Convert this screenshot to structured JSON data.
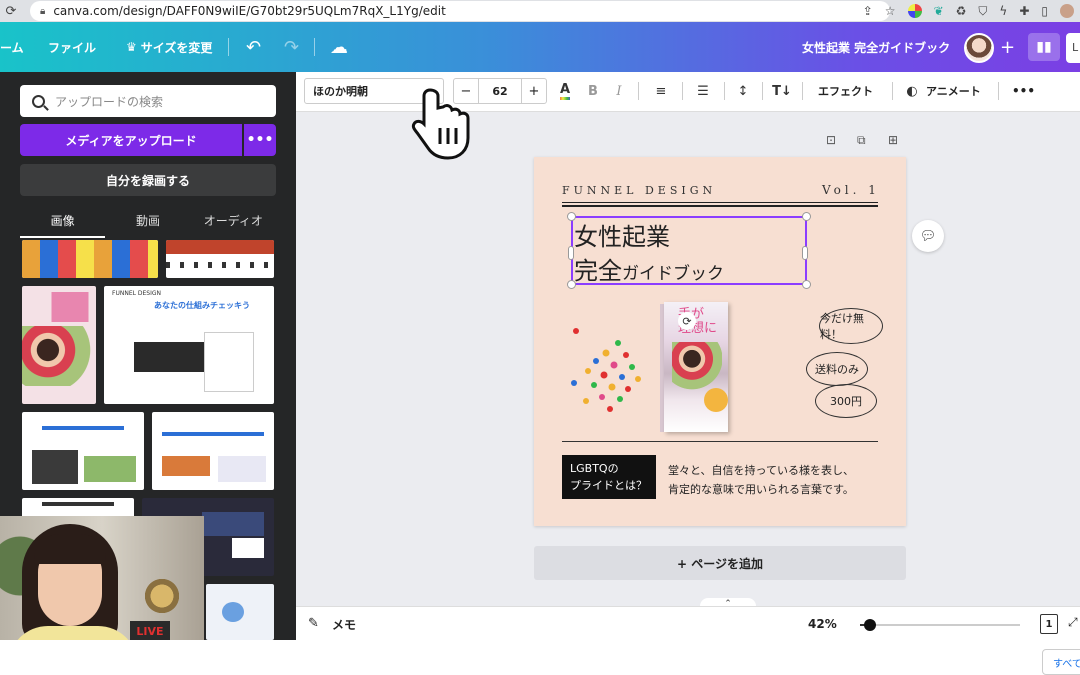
{
  "browser": {
    "url": "canva.com/design/DAFF0N9wiIE/G70bt29r5UQLm7RqX_L1Yg/edit"
  },
  "header": {
    "home_label": "ーム",
    "file_label": "ファイル",
    "resize_label": "サイズを変更",
    "doc_title": "女性起業 完全ガイドブック",
    "share_initial": "L"
  },
  "left_panel": {
    "search_placeholder": "アップロードの検索",
    "upload_label": "メディアをアップロード",
    "more_label": "•••",
    "record_label": "自分を録画する",
    "tabs": [
      {
        "label": "画像",
        "active": true
      },
      {
        "label": "動画",
        "active": false
      },
      {
        "label": "オーディオ",
        "active": false
      }
    ],
    "thumb_brand": "FUNNEL DESIGN",
    "thumb_heading": "あなたの仕組みチェッキう"
  },
  "webcam": {
    "sign_text": "LIVE\nAIR"
  },
  "toolbar": {
    "font_name": "ほのか明朝",
    "font_size": "62",
    "minus": "−",
    "plus": "+",
    "bold": "B",
    "italic": "I",
    "effect_label": "エフェクト",
    "animate_label": "アニメート",
    "more": "•••"
  },
  "design": {
    "brand": "FUNNEL DESIGN",
    "vol": "Vol. 1",
    "title_line1": "女性起業",
    "title_line2_big": "完全",
    "title_line2_small": "ガイドブック",
    "book_title": "手が\n理想に",
    "bubble_free": "今だけ無料！",
    "bubble_shipping": "送料のみ",
    "bubble_price": "300円",
    "lgbt_line1": "LGBTQの",
    "lgbt_line2": "プライドとは？",
    "desc_line1": "堂々と、自信を持っている様を表し、",
    "desc_line2": "肯定的な意味で用いられる言葉です。"
  },
  "canvas": {
    "add_page_label": "+ ページを追加"
  },
  "bottombar": {
    "memo_label": "メモ",
    "zoom_label": "42%",
    "zoom_fraction": 0.42,
    "page_count": "1"
  },
  "footer": {
    "see_all": "すべて"
  },
  "colors": {
    "accent": "#7d2ae8",
    "selection": "#8b3dff",
    "design_bg": "#f7dfd2"
  }
}
